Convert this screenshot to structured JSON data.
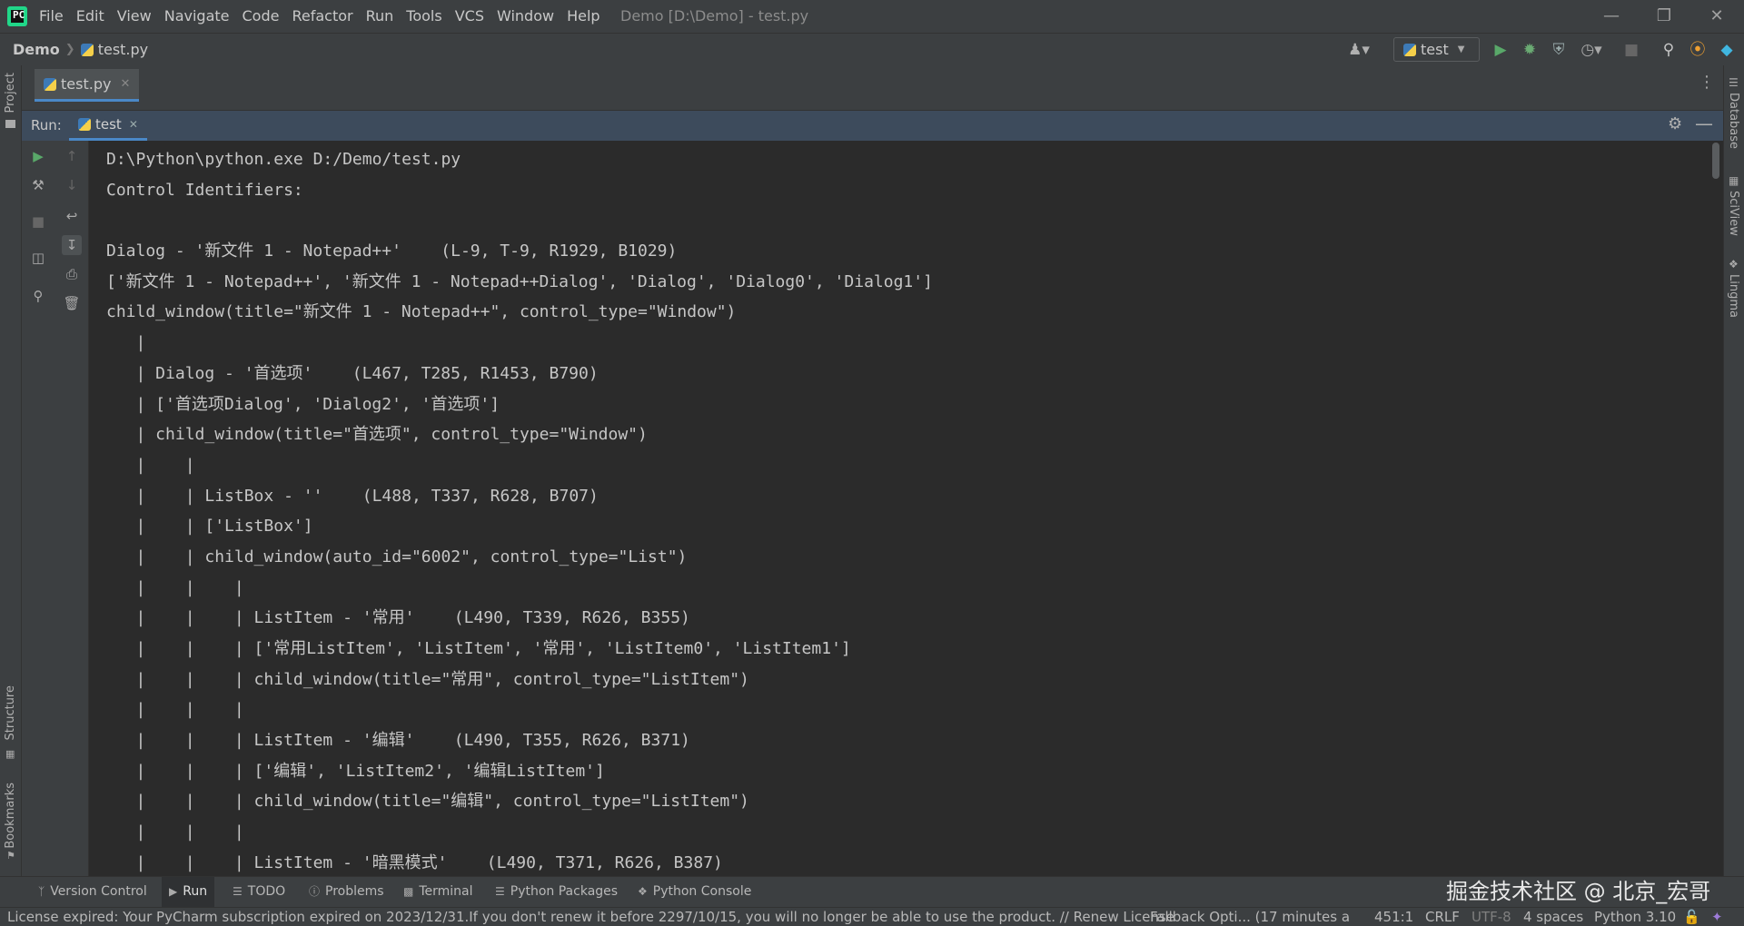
{
  "titlebar": {
    "menu": [
      "File",
      "Edit",
      "View",
      "Navigate",
      "Code",
      "Refactor",
      "Run",
      "Tools",
      "VCS",
      "Window",
      "Help"
    ],
    "window_title": "Demo [D:\\Demo] - test.py"
  },
  "navbar": {
    "project": "Demo",
    "file": "test.py",
    "run_config": "test"
  },
  "left_strip": {
    "project": "Project",
    "structure": "Structure",
    "bookmarks": "Bookmarks"
  },
  "right_strip": {
    "database": "Database",
    "sciview": "SciView",
    "lingma": "Lingma"
  },
  "editor": {
    "tab": "test.py"
  },
  "run_panel": {
    "label": "Run:",
    "tab": "test",
    "lines": [
      "D:\\Python\\python.exe D:/Demo/test.py",
      "Control Identifiers:",
      "",
      "Dialog - '新文件 1 - Notepad++'    (L-9, T-9, R1929, B1029)",
      "['新文件 1 - Notepad++', '新文件 1 - Notepad++Dialog', 'Dialog', 'Dialog0', 'Dialog1']",
      "child_window(title=\"新文件 1 - Notepad++\", control_type=\"Window\")",
      "   |",
      "   | Dialog - '首选项'    (L467, T285, R1453, B790)",
      "   | ['首选项Dialog', 'Dialog2', '首选项']",
      "   | child_window(title=\"首选项\", control_type=\"Window\")",
      "   |    |",
      "   |    | ListBox - ''    (L488, T337, R628, B707)",
      "   |    | ['ListBox']",
      "   |    | child_window(auto_id=\"6002\", control_type=\"List\")",
      "   |    |    |",
      "   |    |    | ListItem - '常用'    (L490, T339, R626, B355)",
      "   |    |    | ['常用ListItem', 'ListItem', '常用', 'ListItem0', 'ListItem1']",
      "   |    |    | child_window(title=\"常用\", control_type=\"ListItem\")",
      "   |    |    |",
      "   |    |    | ListItem - '编辑'    (L490, T355, R626, B371)",
      "   |    |    | ['编辑', 'ListItem2', '编辑ListItem']",
      "   |    |    | child_window(title=\"编辑\", control_type=\"ListItem\")",
      "   |    |    |",
      "   |    |    | ListItem - '暗黑模式'    (L490, T371, R626, B387)"
    ]
  },
  "bottom_tabs": [
    "Version Control",
    "Run",
    "TODO",
    "Problems",
    "Terminal",
    "Python Packages",
    "Python Console"
  ],
  "watermark": "掘金技术社区 @ 北京_宏哥",
  "statusbar": {
    "message": "License expired: Your PyCharm subscription expired on 2023/12/31.If you don't renew it before 2297/10/15, you will no longer be able to use the product. // Renew License",
    "fallback": "Fallback Opti... (17 minutes a",
    "position": "451:1",
    "line_sep": "CRLF",
    "encoding": "UTF-8",
    "indent": "4 spaces",
    "interpreter": "Python 3.10"
  },
  "colors": {
    "accent": "#4a88c7",
    "run_green": "#59a869",
    "debug_green": "#6aab73",
    "update_orange": "#f0a030"
  }
}
